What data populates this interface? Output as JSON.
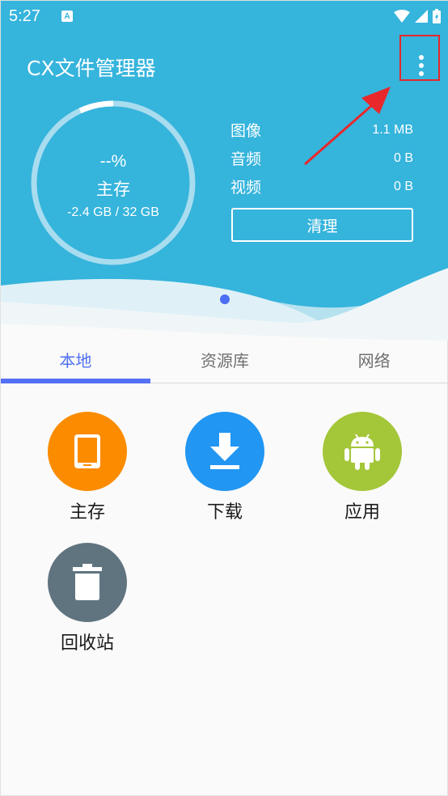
{
  "status_bar": {
    "time": "5:27",
    "notification_icon": "A",
    "icons": [
      "wifi-icon",
      "signal-icon",
      "battery-charging-icon"
    ]
  },
  "header": {
    "app_title": "CX文件管理器",
    "menu_icon": "more-vert-icon"
  },
  "storage_ring": {
    "percent_text": "--%",
    "label": "主存",
    "usage_text": "-2.4 GB / 32 GB"
  },
  "media_stats": [
    {
      "label": "图像",
      "value": "1.1 MB"
    },
    {
      "label": "音频",
      "value": "0 B"
    },
    {
      "label": "视频",
      "value": "0 B"
    }
  ],
  "clean_button_label": "清理",
  "tabs": [
    {
      "label": "本地",
      "active": true
    },
    {
      "label": "资源库",
      "active": false
    },
    {
      "label": "网络",
      "active": false
    }
  ],
  "grid_items": [
    {
      "label": "主存",
      "icon": "tablet-icon",
      "color": "#fb8c00"
    },
    {
      "label": "下载",
      "icon": "download-icon",
      "color": "#2196f3"
    },
    {
      "label": "应用",
      "icon": "android-icon",
      "color": "#a4c639"
    },
    {
      "label": "回收站",
      "icon": "trash-icon",
      "color": "#607480"
    }
  ],
  "colors": {
    "header_bg": "#35b4dc",
    "accent": "#5470f5",
    "annotation_red": "#e8282b"
  }
}
